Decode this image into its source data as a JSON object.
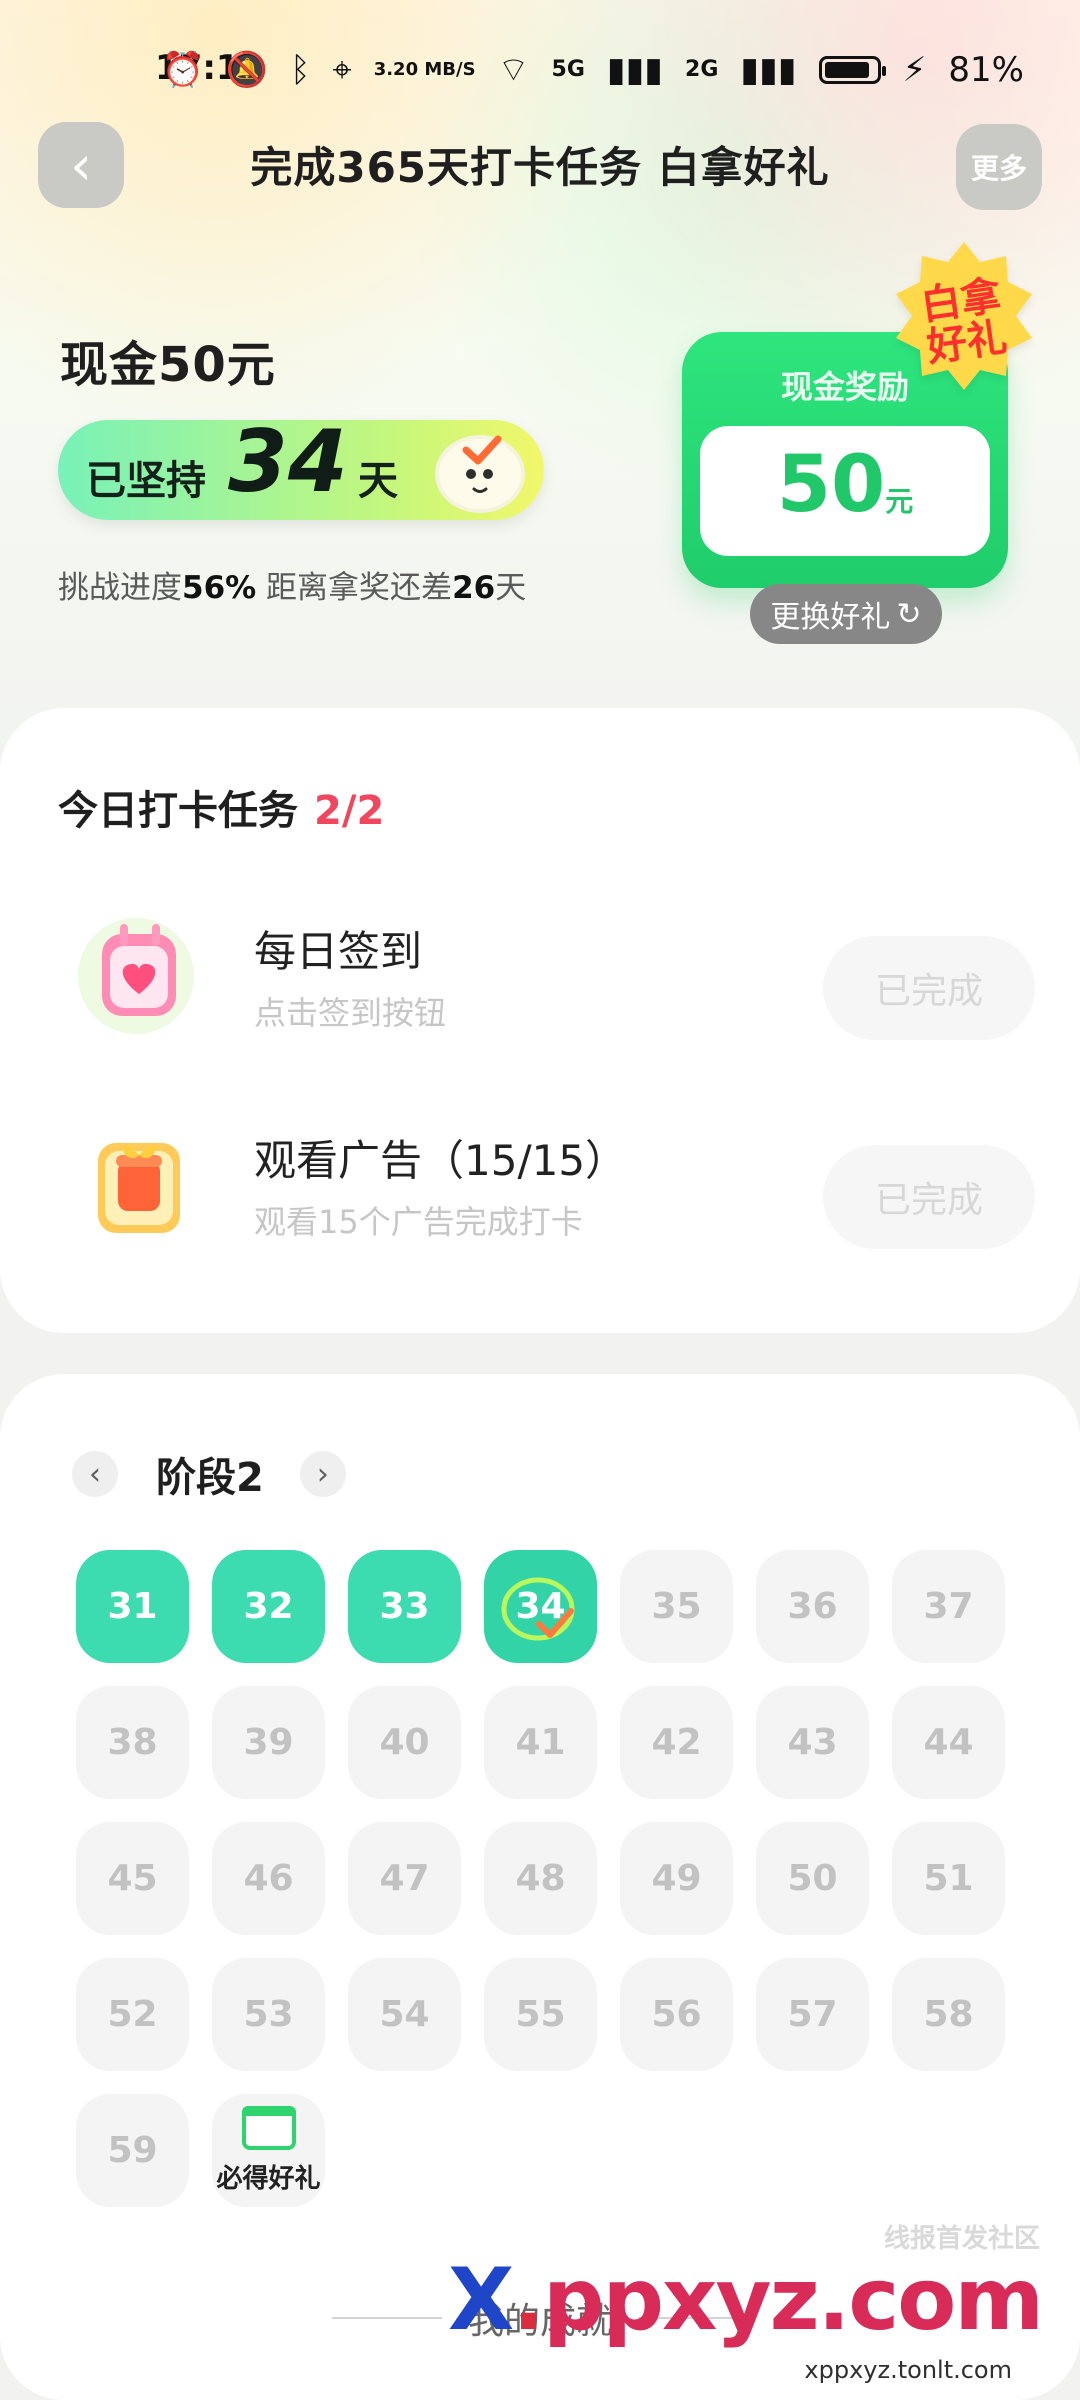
{
  "status": {
    "time": "17:12",
    "network_speed": "3.20 MB/S",
    "net1": "5G",
    "net2": "2G",
    "battery": "81%"
  },
  "header": {
    "title": "完成365天打卡任务 白拿好礼",
    "more": "更多"
  },
  "hero": {
    "cash_title": "现金50元",
    "streak_label": "已坚持",
    "streak_days": "34",
    "streak_unit": "天",
    "progress_prefix": "挑战进度",
    "progress_value": "56%",
    "progress_middle": " 距离拿奖还差",
    "remaining_days": "26",
    "remaining_unit": "天"
  },
  "reward": {
    "label": "现金奖励",
    "amount": "50",
    "unit": "元",
    "badge_top": "白拿",
    "badge_bottom": "好礼",
    "change_button": "更换好礼"
  },
  "tasks": {
    "heading": "今日打卡任务",
    "count": "2/2",
    "items": [
      {
        "title": "每日签到",
        "subtitle": "点击签到按钮",
        "button": "已完成"
      },
      {
        "title": "观看广告（15/15）",
        "subtitle": "观看15个广告完成打卡",
        "button": "已完成"
      }
    ]
  },
  "stage": {
    "title": "阶段2",
    "days": [
      "31",
      "32",
      "33",
      "34",
      "35",
      "36",
      "37",
      "38",
      "39",
      "40",
      "41",
      "42",
      "43",
      "44",
      "45",
      "46",
      "47",
      "48",
      "49",
      "50",
      "51",
      "52",
      "53",
      "54",
      "55",
      "56",
      "57",
      "58",
      "59"
    ],
    "gift_label": "必得好礼",
    "section_label": "我的成就"
  },
  "watermark": {
    "line1": "线报首发社区",
    "brand_x": "X",
    "brand_dot": ".",
    "brand_rest": "ppxyz.com",
    "url": "xppxyz.tonlt.com"
  },
  "colors": {
    "accent_green": "#2ED47A",
    "accent_mint": "#3DDBB0",
    "accent_red": "#F0465E"
  }
}
